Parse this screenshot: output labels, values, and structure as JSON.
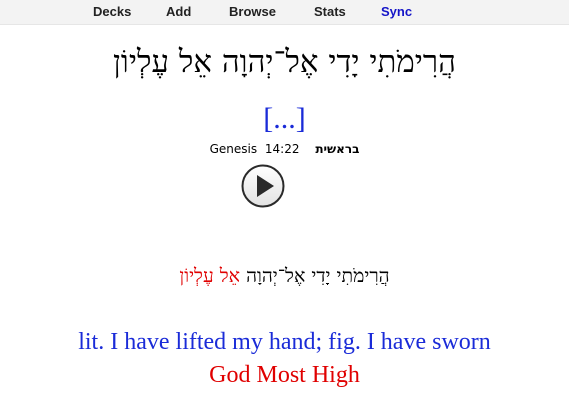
{
  "nav": {
    "decks": "Decks",
    "add": "Add",
    "browse": "Browse",
    "stats": "Stats",
    "sync": "Sync"
  },
  "card": {
    "hebrew_phrase": "הֲרִימֹתִי יָדִי אֶל־יְהוָה אֵל עֶלְיוֹן",
    "cloze": "[...]",
    "reference": {
      "book_en": "Genesis",
      "chapter_verse": "14:22",
      "book_he": "בראשית"
    },
    "play_icon": "play-icon",
    "answer": {
      "hebrew_black": "הֲרִימֹתִי יָדִי אֶל־יְהוָה",
      "hebrew_red": "אֵל עֶלְיוֹן"
    },
    "gloss": "lit. I have lifted my hand; fig. I have sworn",
    "gloss_answer": "God Most High"
  },
  "colors": {
    "blue": "#1a2bd8",
    "red": "#e00000",
    "nav_active": "#1515c8"
  }
}
